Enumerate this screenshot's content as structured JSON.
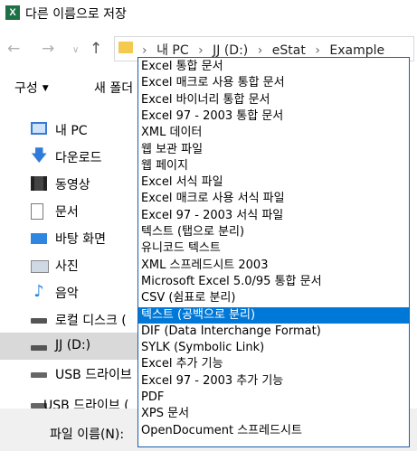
{
  "window": {
    "title": "다른 이름으로 저장",
    "app_icon_letter": "X"
  },
  "nav": {
    "breadcrumbs": [
      "내 PC",
      "JJ (D:)",
      "eStat",
      "Example"
    ]
  },
  "toolbar": {
    "organize_label": "구성",
    "new_folder_label": "새 폴더"
  },
  "sidebar": {
    "items": [
      {
        "label": "내 PC",
        "icon": "pc-icon"
      },
      {
        "label": "다운로드",
        "icon": "download-icon"
      },
      {
        "label": "동영상",
        "icon": "video-icon"
      },
      {
        "label": "문서",
        "icon": "document-icon"
      },
      {
        "label": "바탕 화면",
        "icon": "desktop-icon"
      },
      {
        "label": "사진",
        "icon": "pictures-icon"
      },
      {
        "label": "음악",
        "icon": "music-icon"
      },
      {
        "label": "로컬 디스크 (",
        "icon": "drive-icon"
      },
      {
        "label": "JJ (D:)",
        "icon": "drive-icon"
      },
      {
        "label": "USB 드라이브",
        "icon": "usb-drive-icon"
      },
      {
        "label": "USB 드라이브 (",
        "icon": "usb-drive-icon"
      }
    ],
    "selected_index": 8
  },
  "bottom": {
    "filename_label": "파일 이름(N):"
  },
  "file_types": {
    "selected_index": 15,
    "options": [
      "Excel 통합 문서",
      "Excel 매크로 사용 통합 문서",
      "Excel 바이너리 통합 문서",
      "Excel 97 - 2003 통합 문서",
      "XML 데이터",
      "웹 보관 파일",
      "웹 페이지",
      "Excel 서식 파일",
      "Excel 매크로 사용 서식 파일",
      "Excel 97 - 2003 서식 파일",
      "텍스트 (탭으로 분리)",
      "유니코드 텍스트",
      "XML 스프레드시트 2003",
      "Microsoft Excel 5.0/95 통합 문서",
      "CSV (쉼표로 분리)",
      "텍스트 (공백으로 분리)",
      "DIF (Data Interchange Format)",
      "SYLK (Symbolic Link)",
      "Excel 추가 기능",
      "Excel 97 - 2003 추가 기능",
      "PDF",
      "XPS 문서",
      "OpenDocument 스프레드시트"
    ]
  },
  "colors": {
    "selection": "#0078d7",
    "dropdown_border": "#1c5ea6",
    "excel_green": "#1e7145"
  }
}
